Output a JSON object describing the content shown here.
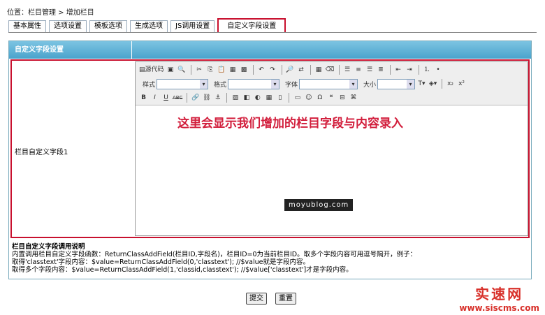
{
  "breadcrumb": "位置：栏目管理 > 增加栏目",
  "tabs": [
    {
      "label": "基本属性"
    },
    {
      "label": "选项设置"
    },
    {
      "label": "模板选项"
    },
    {
      "label": "生成选项"
    },
    {
      "label": "JS调用设置"
    },
    {
      "label": "自定义字段设置",
      "active": true
    }
  ],
  "section": {
    "title": "自定义字段设置"
  },
  "field": {
    "label": "栏目自定义字段1"
  },
  "editor": {
    "toolbar": {
      "source_label": "源代码",
      "style_label": "样式",
      "format_label": "格式",
      "font_label": "字体",
      "size_label": "大小",
      "bold": "B",
      "italic": "I",
      "underline": "U",
      "strike": "ABC"
    },
    "annotation": "这里会显示我们增加的栏目字段与内容录入",
    "watermark": "moyublog.com"
  },
  "help": {
    "title": "栏目自定义字段调用说明",
    "lines": [
      "内置调用栏目自定义字段函数：ReturnClassAddField(栏目ID,字段名)，栏目ID=0为当前栏目ID。取多个字段内容可用逗号隔开，例子：",
      "取得'classtext'字段内容：$value=ReturnClassAddField(0,'classtext'); //$value就是字段内容。",
      "取得多个字段内容：$value=ReturnClassAddField(1,'classid,classtext'); //$value['classtext']才是字段内容。"
    ]
  },
  "actions": {
    "submit": "提交",
    "reset": "重置"
  },
  "logo": {
    "cn": "实速网",
    "en": "www.siscms.com"
  }
}
